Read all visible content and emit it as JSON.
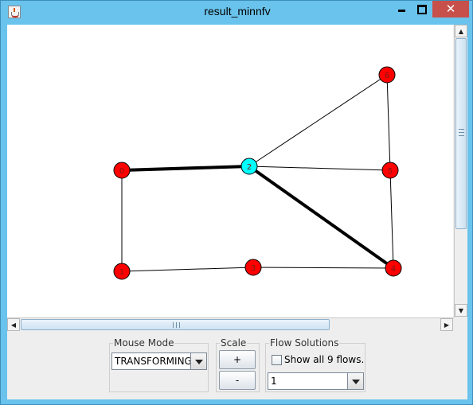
{
  "window": {
    "title": "result_minnfv",
    "close_glyph": "✕"
  },
  "graph": {
    "nodes": [
      {
        "id": "0",
        "label": "0",
        "color": "#ff0000"
      },
      {
        "id": "1",
        "label": "1",
        "color": "#ff0000"
      },
      {
        "id": "2",
        "label": "2",
        "color": "#00ffff"
      },
      {
        "id": "3",
        "label": "3",
        "color": "#ff0000"
      },
      {
        "id": "4",
        "label": "4",
        "color": "#ff0000"
      },
      {
        "id": "5",
        "label": "5",
        "color": "#ff0000"
      },
      {
        "id": "6",
        "label": "6",
        "color": "#ff0000"
      }
    ],
    "edges": [
      {
        "from": "0",
        "to": "2",
        "flow": true
      },
      {
        "from": "2",
        "to": "4",
        "flow": true
      },
      {
        "from": "0",
        "to": "1",
        "flow": false
      },
      {
        "from": "1",
        "to": "3",
        "flow": false
      },
      {
        "from": "3",
        "to": "4",
        "flow": false
      },
      {
        "from": "2",
        "to": "5",
        "flow": false
      },
      {
        "from": "2",
        "to": "6",
        "flow": false
      },
      {
        "from": "6",
        "to": "5",
        "flow": false
      },
      {
        "from": "5",
        "to": "4",
        "flow": false
      }
    ]
  },
  "controls": {
    "mouse_mode": {
      "title": "Mouse Mode",
      "selected": "TRANSFORMING"
    },
    "scale": {
      "title": "Scale",
      "plus_label": "+",
      "minus_label": "-"
    },
    "flow_solutions": {
      "title": "Flow Solutions",
      "show_all_label": "Show all 9 flows.",
      "show_all_checked": false,
      "selected": "1"
    }
  },
  "scrollbars": {
    "up_arrow": "▲",
    "down_arrow": "▼",
    "left_arrow": "◀",
    "right_arrow": "▶"
  }
}
